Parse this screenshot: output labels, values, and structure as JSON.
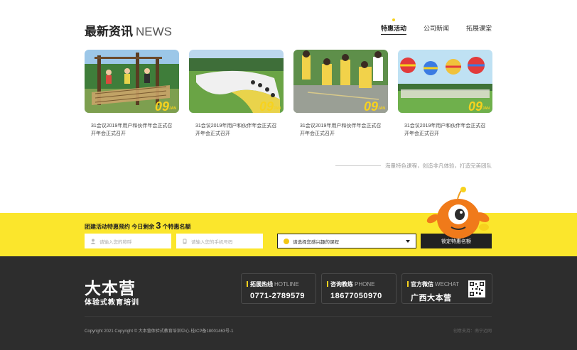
{
  "news": {
    "title_cn": "最新资讯",
    "title_en": "NEWS",
    "tabs": [
      "特惠活动",
      "公司新闻",
      "拓展课堂"
    ],
    "active_tab": 0,
    "cards": [
      {
        "day": "09",
        "month": "JAN",
        "text": "31会议2019年用户和伙伴年会正式召开年会正式召开"
      },
      {
        "day": "09",
        "month": "JAN",
        "text": "31会议2019年用户和伙伴年会正式召开年会正式召开"
      },
      {
        "day": "09",
        "month": "JAN",
        "text": "31会议2019年用户和伙伴年会正式召开年会正式召开"
      },
      {
        "day": "09",
        "month": "JAN",
        "text": "31会议2019年用户和伙伴年会正式召开年会正式召开"
      }
    ],
    "slogan": "海量特色课程，创造非凡体验，打造完美团队"
  },
  "booking": {
    "title_prefix": "团建活动特惠预约  今日剩余",
    "remaining": "3",
    "title_suffix": "个特惠名额",
    "name_placeholder": "请输入您的称呼",
    "phone_placeholder": "请输入您的手机号码",
    "course_select": "请选择您感兴趣的课程",
    "submit": "锁定特惠名额"
  },
  "footer": {
    "logo_big": "大本营",
    "logo_small": "体验式教育培训",
    "contacts": [
      {
        "label": "拓展热线",
        "label_en": "HOTLINE",
        "value": "0771-2789579"
      },
      {
        "label": "咨询教练",
        "label_en": "PHONE",
        "value": "18677050970"
      },
      {
        "label": "官方微信",
        "label_en": "WECHAT",
        "value": "广西大本营"
      }
    ],
    "copyright": "Copyright 2021 Copyright © 大本营体验式教育培训中心 桂ICP备18001463号-1",
    "support": "创意支持：南宁迈网"
  },
  "colors": {
    "accent": "#f7d21e",
    "band": "#fbe62c",
    "footer_bg": "#2d2d2d"
  }
}
